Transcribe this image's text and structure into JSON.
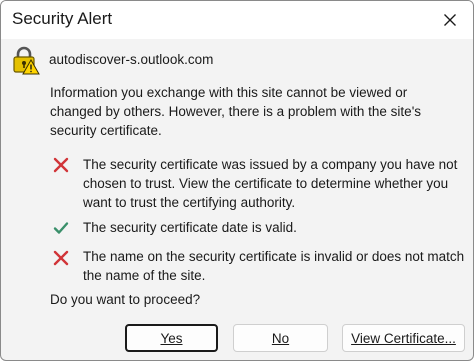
{
  "window": {
    "title": "Security Alert"
  },
  "site": "autodiscover-s.outlook.com",
  "intro_text": "Information you exchange with this site cannot be viewed or changed by others. However, there is a problem with the site's security certificate.",
  "items": [
    {
      "status": "error",
      "icon": "x-icon",
      "text": "The security certificate was issued by a company you have not chosen to trust. View the certificate to determine whether you want to trust the certifying authority."
    },
    {
      "status": "ok",
      "icon": "check-icon",
      "text": "The security certificate date is valid."
    },
    {
      "status": "error",
      "icon": "x-icon",
      "text": "The name on the security certificate is invalid or does not match the name of the site."
    }
  ],
  "question": "Do you want to proceed?",
  "buttons": {
    "yes": "Yes",
    "no": "No",
    "view_certificate": "View Certificate..."
  },
  "colors": {
    "error": "#d13438",
    "ok": "#3a8f6a",
    "lock": "#e5c100"
  }
}
